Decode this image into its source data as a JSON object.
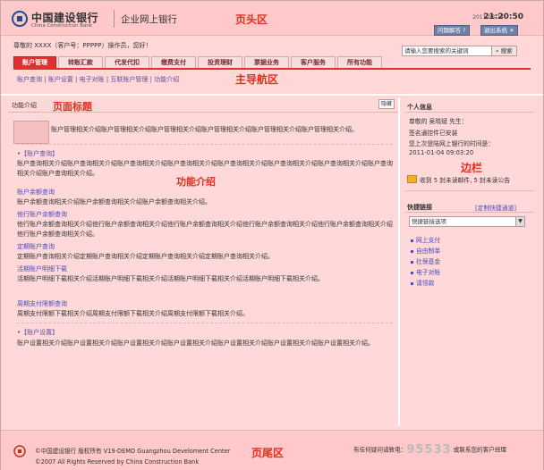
{
  "header": {
    "bank_cn": "中国建设银行",
    "bank_en": "China Construction Bank",
    "subtitle": "企业网上银行",
    "region_label": "页头区",
    "date": "2011-03-14",
    "time": "21:20:50",
    "help_btn": "问题解答",
    "logout_btn": "退出系统"
  },
  "userbar": {
    "text": "尊敬的 XXXX（客户号：PPPPP）操作员，您好！"
  },
  "search": {
    "placeholder": "请输入您要搜索的关键词",
    "button": "搜索"
  },
  "tabs": [
    "账户管理",
    "转账汇款",
    "代发代扣",
    "缴费支付",
    "投资理财",
    "票据业务",
    "客户服务",
    "所有功能"
  ],
  "nav_label": "主导航区",
  "subnav": "账户查询 | 账户设置 | 电子对账 | 互联账户管理 | 功能介绍",
  "main": {
    "page_title": "功能介绍",
    "page_title_label": "页面标题",
    "hide_btn": "隐藏",
    "func_label": "功能介绍",
    "intro": "账户管理相关介绍账户管理相关介绍账户管理相关介绍账户管理相关介绍账户管理相关介绍账户管理相关介绍。",
    "sec1_title": "•【账户查询】",
    "sec1_text": "账户查询相关介绍账户查询相关介绍账户查询相关介绍账户查询相关介绍账户查询相关介绍账户查询相关介绍账户查询相关介绍账户查询相关介绍账户查询相关介绍。",
    "sub1_title": "账户余额查询",
    "sub1_text": "账户余额查询相关介绍账户余额查询相关介绍账户余额查询相关介绍。",
    "sub2_title": "他行账户余额查询",
    "sub2_text": "他行账户余额查询相关介绍他行账户余额查询相关介绍他行账户余额查询相关介绍他行账户余额查询相关介绍他行账户余额查询相关介绍他行账户余额查询相关介绍。",
    "sub3_title": "定期账户查询",
    "sub3_text": "定期账户查询相关介绍定期账户查询相关介绍定期账户查询相关介绍定期账户查询相关介绍。",
    "sub4_title": "活期账户明细下载",
    "sub4_text": "活期账户明细下载相关介绍活期账户明细下载相关介绍活期账户明细下载相关介绍活期账户明细下载相关介绍。",
    "sub5_title": "周期支付限额查询",
    "sub5_text": "周期支付限额下载相关介绍周期支付限额下载相关介绍周期支付限额下载相关介绍。",
    "sec2_title": "•【账户设置】",
    "sec2_text": "账户设置相关介绍账户设置相关介绍账户设置相关介绍账户设置相关介绍账户设置相关介绍账户设置相关介绍账户设置相关介绍。"
  },
  "sidebar": {
    "label": "边栏",
    "personal_title": "个人信息",
    "greeting": "尊敬的 吴晓斌 先生：",
    "cert": "签名通控件已安装",
    "last_login_label": "您上次登陆网上银行的时间是：",
    "last_login": "2011-01-04 09:03:20",
    "mail": "收到 5 封未读邮件, 5 封未读公告",
    "quick_title": "快捷链接",
    "custom_link": "[定制快捷通道]",
    "select_value": "快捷链接选项",
    "links": [
      "网上支付",
      "自由制单",
      "社保基金",
      "电子对账",
      "请领款"
    ]
  },
  "footer": {
    "label": "页尾区",
    "line1": "©中国建设银行 版权所有 V19-DEMO Guangzhou Develoment Center",
    "line2": "©2007 All Rights Reserved by China Construction Bank",
    "hotline_prefix": "有任何疑问请致电：",
    "hotline_number": "95533",
    "hotline_suffix": " 或联系您的客户经理"
  },
  "colors": {
    "accent": "#e03030",
    "link": "#4a4abb",
    "background": "#ffd9d9"
  }
}
